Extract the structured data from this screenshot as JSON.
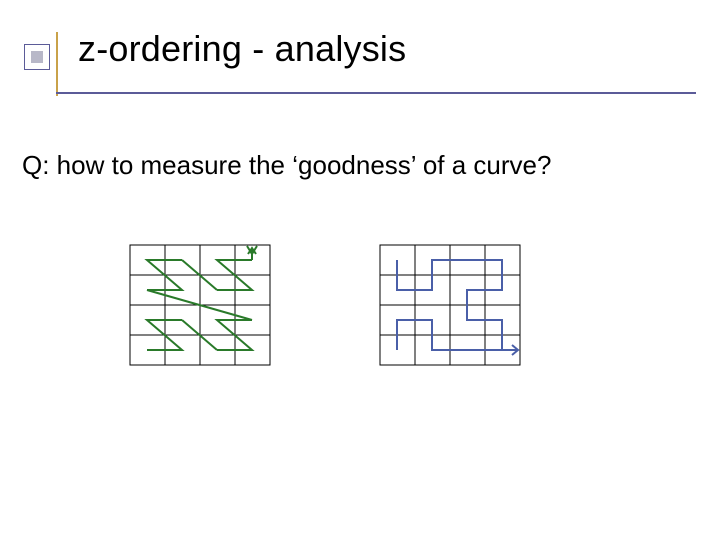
{
  "title": "z-ordering - analysis",
  "body": "Q: how to measure the ‘goodness’ of a curve?",
  "figures": {
    "left": {
      "type": "z-curve",
      "grid": "4x4"
    },
    "right": {
      "type": "hilbert-curve",
      "grid": "4x4"
    }
  }
}
